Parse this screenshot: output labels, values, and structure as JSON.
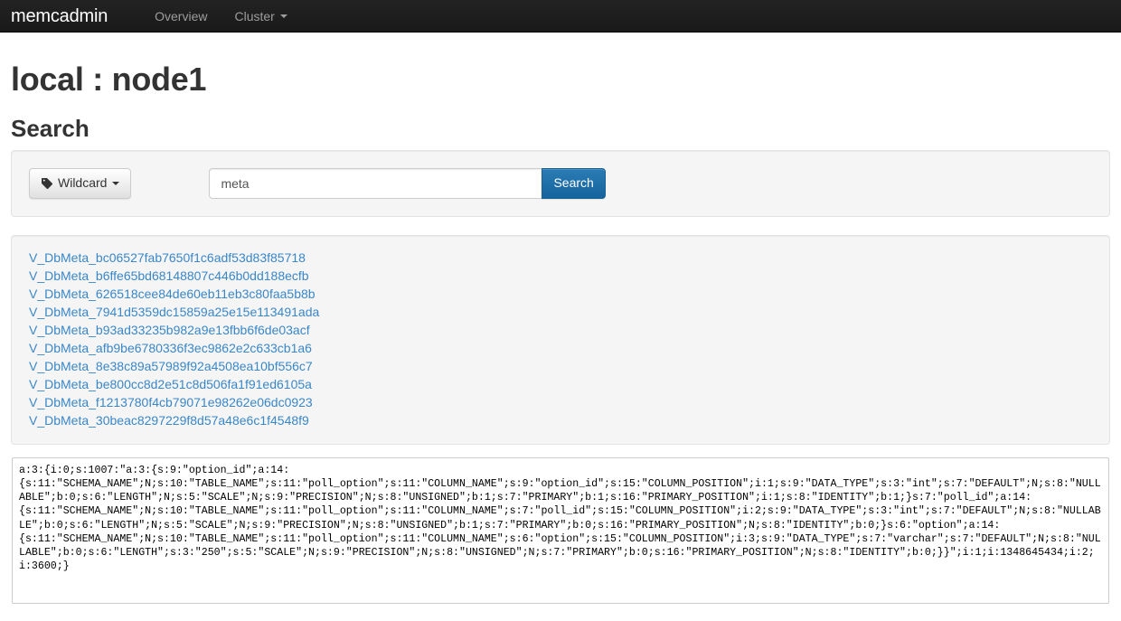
{
  "navbar": {
    "brand": "memcadmin",
    "items": [
      {
        "label": "Overview",
        "has_caret": false
      },
      {
        "label": "Cluster",
        "has_caret": true
      }
    ]
  },
  "page": {
    "title": "local : node1",
    "section_title": "Search"
  },
  "search": {
    "mode_button_label": "Wildcard",
    "mode_icon": "tag-icon",
    "input_value": "meta",
    "input_placeholder": "",
    "submit_label": "Search"
  },
  "results": {
    "items": [
      "V_DbMeta_bc06527fab7650f1c6adf53d83f85718",
      "V_DbMeta_b6ffe65bd68148807c446b0dd188ecfb",
      "V_DbMeta_626518cee84de60eb11eb3c80faa5b8b",
      "V_DbMeta_7941d5359dc15859a25e15e113491ada",
      "V_DbMeta_b93ad33235b982a9e13fbb6f6de03acf",
      "V_DbMeta_afb9be6780336f3ec9862e2c633cb1a6",
      "V_DbMeta_8e38c89a57989f92a4508ea10bf556c7",
      "V_DbMeta_be800cc8d2e51c8d506fa1f91ed6105a",
      "V_DbMeta_f1213780f4cb79071e98262e06dc0923",
      "V_DbMeta_30beac8297229f8d57a48e6c1f4548f9"
    ]
  },
  "raw_value": {
    "content": "a:3:{i:0;s:1007:\"a:3:{s:9:\"option_id\";a:14:\n{s:11:\"SCHEMA_NAME\";N;s:10:\"TABLE_NAME\";s:11:\"poll_option\";s:11:\"COLUMN_NAME\";s:9:\"option_id\";s:15:\"COLUMN_POSITION\";i:1;s:9:\"DATA_TYPE\";s:3:\"int\";s:7:\"DEFAULT\";N;s:8:\"NULLABLE\";b:0;s:6:\"LENGTH\";N;s:5:\"SCALE\";N;s:9:\"PRECISION\";N;s:8:\"UNSIGNED\";b:1;s:7:\"PRIMARY\";b:1;s:16:\"PRIMARY_POSITION\";i:1;s:8:\"IDENTITY\";b:1;}s:7:\"poll_id\";a:14:\n{s:11:\"SCHEMA_NAME\";N;s:10:\"TABLE_NAME\";s:11:\"poll_option\";s:11:\"COLUMN_NAME\";s:7:\"poll_id\";s:15:\"COLUMN_POSITION\";i:2;s:9:\"DATA_TYPE\";s:3:\"int\";s:7:\"DEFAULT\";N;s:8:\"NULLABLE\";b:0;s:6:\"LENGTH\";N;s:5:\"SCALE\";N;s:9:\"PRECISION\";N;s:8:\"UNSIGNED\";b:1;s:7:\"PRIMARY\";b:0;s:16:\"PRIMARY_POSITION\";N;s:8:\"IDENTITY\";b:0;}s:6:\"option\";a:14:\n{s:11:\"SCHEMA_NAME\";N;s:10:\"TABLE_NAME\";s:11:\"poll_option\";s:11:\"COLUMN_NAME\";s:6:\"option\";s:15:\"COLUMN_POSITION\";i:3;s:9:\"DATA_TYPE\";s:7:\"varchar\";s:7:\"DEFAULT\";N;s:8:\"NULLABLE\";b:0;s:6:\"LENGTH\";s:3:\"250\";s:5:\"SCALE\";N;s:9:\"PRECISION\";N;s:8:\"UNSIGNED\";N;s:7:\"PRIMARY\";b:0;s:16:\"PRIMARY_POSITION\";N;s:8:\"IDENTITY\";b:0;}}\";i:1;i:1348645434;i:2;i:3600;}"
  },
  "colors": {
    "navbar_bg": "#1e1e1e",
    "navbar_text": "#9d9d9d",
    "link": "#3a87c8",
    "primary_button": "#15639c",
    "well_bg": "#f5f5f5",
    "well_border": "#e3e3e3",
    "text": "#333333"
  }
}
